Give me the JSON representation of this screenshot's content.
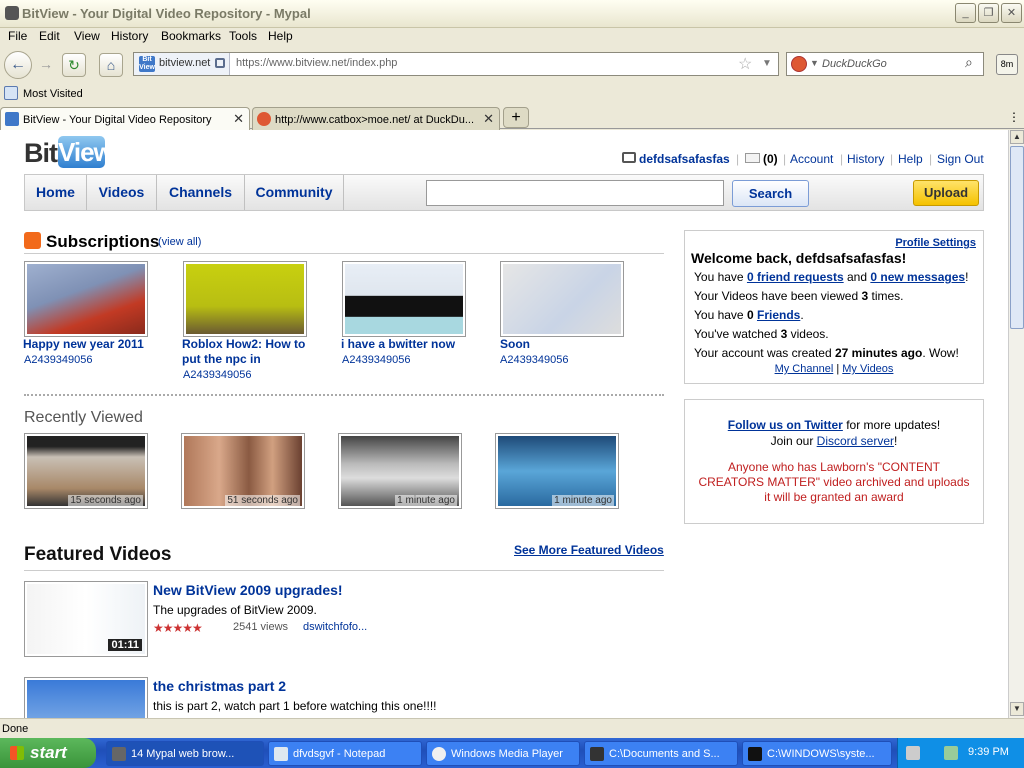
{
  "window": {
    "title": "BitView - Your Digital Video Repository - Mypal"
  },
  "menu": [
    "File",
    "Edit",
    "View",
    "History",
    "Bookmarks",
    "Tools",
    "Help"
  ],
  "urlbar": {
    "site": "bitview.net",
    "url": "https://www.bitview.net/index.php"
  },
  "searchbar": {
    "placeholder": "DuckDuckGo"
  },
  "bookmarks": {
    "most_visited": "Most Visited"
  },
  "tabs": [
    {
      "title": "BitView - Your Digital Video Repository"
    },
    {
      "title": "http://www.catbox>moe.net/ at DuckDu..."
    }
  ],
  "status": "Done",
  "page": {
    "logo": {
      "bit": "Bit",
      "view": "View"
    },
    "user": {
      "name": "defdsafsafasfas",
      "messages": "(0)",
      "account": "Account",
      "history": "History",
      "help": "Help",
      "signout": "Sign Out"
    },
    "nav": {
      "home": "Home",
      "videos": "Videos",
      "channels": "Channels",
      "community": "Community",
      "search": "Search",
      "upload": "Upload"
    },
    "subscriptions": {
      "title": "Subscriptions",
      "view_all": "(view all)",
      "items": [
        {
          "title": "Happy new year 2011",
          "user": "A2439349056"
        },
        {
          "title": "Roblox How2: How to put the npc in",
          "user": "A2439349056"
        },
        {
          "title": "i have a bwitter now",
          "user": "A2439349056"
        },
        {
          "title": "Soon",
          "user": "A2439349056"
        }
      ]
    },
    "recent": {
      "title": "Recently Viewed",
      "items": [
        {
          "time": "15 seconds ago"
        },
        {
          "time": "51 seconds ago"
        },
        {
          "time": "1 minute ago"
        },
        {
          "time": "1 minute ago"
        }
      ]
    },
    "featured": {
      "title": "Featured Videos",
      "more": "See More Featured Videos",
      "items": [
        {
          "title": "New BitView 2009 upgrades!",
          "desc": "The upgrades of BitView 2009.",
          "views": "2541 views",
          "author": "dswitchfofo...",
          "duration": "01:11",
          "stars": "★★★★★"
        },
        {
          "title": "the christmas part 2",
          "desc": "this is part 2, watch part 1 before watching this one!!!!"
        }
      ]
    },
    "welcome": {
      "profile_settings": "Profile Settings",
      "title": "Welcome back, defdsafsafasfas!",
      "l1a": "You have ",
      "l1b": "0 friend requests",
      "l1c": " and ",
      "l1d": "0 new messages",
      "l1e": "!",
      "l2a": "Your Videos have been viewed ",
      "l2b": "3",
      "l2c": " times.",
      "l3a": "You have ",
      "l3b": "0",
      "l3c": " ",
      "l3d": "Friends",
      "l3e": ".",
      "l4a": "You've watched ",
      "l4b": "3",
      "l4c": " videos.",
      "l5a": "Your account was created ",
      "l5b": "27 minutes ago",
      "l5c": ". Wow!",
      "my_channel": "My Channel",
      "sep": " | ",
      "my_videos": "My Videos"
    },
    "social": {
      "twitter": "Follow us on Twitter",
      "twitter_rest": " for more updates!",
      "join": "Join our ",
      "discord": "Discord server",
      "excl": "!",
      "award": "Anyone who has Lawborn's \"CONTENT CREATORS MATTER\" video archived and uploads it will be granted an award"
    }
  },
  "taskbar": {
    "start": "start",
    "items": [
      "14 Mypal web brow...",
      "dfvdsgvf - Notepad",
      "Windows Media Player",
      "C:\\Documents and S...",
      "C:\\WINDOWS\\syste..."
    ],
    "clock": "9:39 PM"
  },
  "download_badge": "8m",
  "colors": {
    "link": "#003399",
    "accent": "#3f78c8",
    "upload": "#f5c200",
    "award": "#c02020"
  },
  "icons": [
    "back-icon",
    "forward-icon",
    "reload-icon",
    "home-icon",
    "lock-icon",
    "star-icon",
    "search-icon",
    "rss-icon",
    "tv-icon",
    "mail-icon",
    "close-icon",
    "plus-icon"
  ]
}
